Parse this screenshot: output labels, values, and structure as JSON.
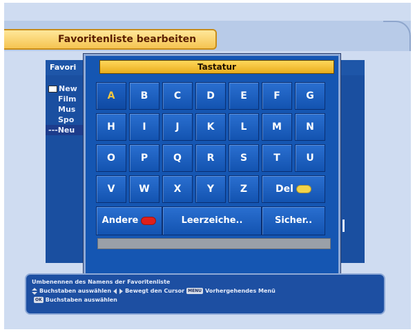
{
  "menu": {
    "title": "Favoritenliste bearbeiten"
  },
  "background_panel": {
    "header": "Favori",
    "items": [
      {
        "label": "New",
        "has_folder_icon": true
      },
      {
        "label": "Film"
      },
      {
        "label": "Mus"
      },
      {
        "label": "Spo"
      },
      {
        "label": "---Neu",
        "selected": true
      }
    ]
  },
  "keyboard": {
    "title": "Tastatur",
    "keys": [
      [
        "A",
        "B",
        "C",
        "D",
        "E",
        "F",
        "G"
      ],
      [
        "H",
        "I",
        "J",
        "K",
        "L",
        "M",
        "N"
      ],
      [
        "O",
        "P",
        "Q",
        "R",
        "S",
        "T",
        "U"
      ],
      [
        "V",
        "W",
        "X",
        "Y",
        "Z"
      ]
    ],
    "selected_key": "A",
    "del_label": "Del",
    "other_label": "Andere",
    "space_label": "Leerzeiche..",
    "save_label": "Sicher..",
    "input_value": ""
  },
  "colors": {
    "red_button": "#e0201a",
    "yellow_button": "#f2d34a",
    "accent_title": "#f5c451",
    "selected_key_text": "#f2c640"
  },
  "help": {
    "title": "Umbenennen des Namens der Favoritenliste",
    "select_letters": "Buchstaben auswählen",
    "move_cursor": "Bewegt den Cursor",
    "menu_key": "MENU",
    "previous_menu": "Vorhergehendes Menü",
    "ok_key": "OK",
    "ok_action": "Buchstaben auswählen"
  }
}
